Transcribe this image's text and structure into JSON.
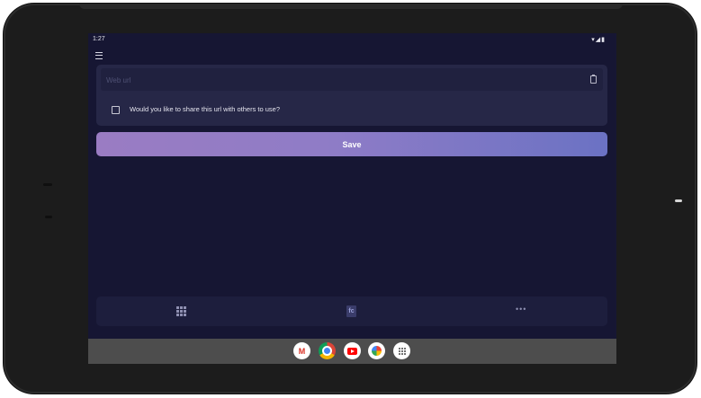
{
  "status_bar": {
    "time": "1:27",
    "icons": "▾◢▮"
  },
  "header": {
    "menu_icon": "menu-icon"
  },
  "form": {
    "url_placeholder": "Web url",
    "clipboard_icon": "clipboard-icon",
    "share_checkbox_checked": false,
    "share_label": "Would you like to share this url with others to use?"
  },
  "save_label": "Save",
  "bottom_nav": {
    "items": [
      {
        "icon": "grid-icon"
      },
      {
        "icon": "app-logo-icon",
        "glyph": "fc"
      },
      {
        "icon": "more-icon",
        "glyph": "•••"
      }
    ]
  },
  "dock": {
    "apps": [
      "gmail-icon",
      "chrome-icon",
      "youtube-icon",
      "photos-icon",
      "app-drawer-icon"
    ],
    "gmail_glyph": "M"
  },
  "colors": {
    "background": "#161633",
    "card": "#262747",
    "accent_start": "#9a7cc3",
    "accent_end": "#6b72c4"
  }
}
